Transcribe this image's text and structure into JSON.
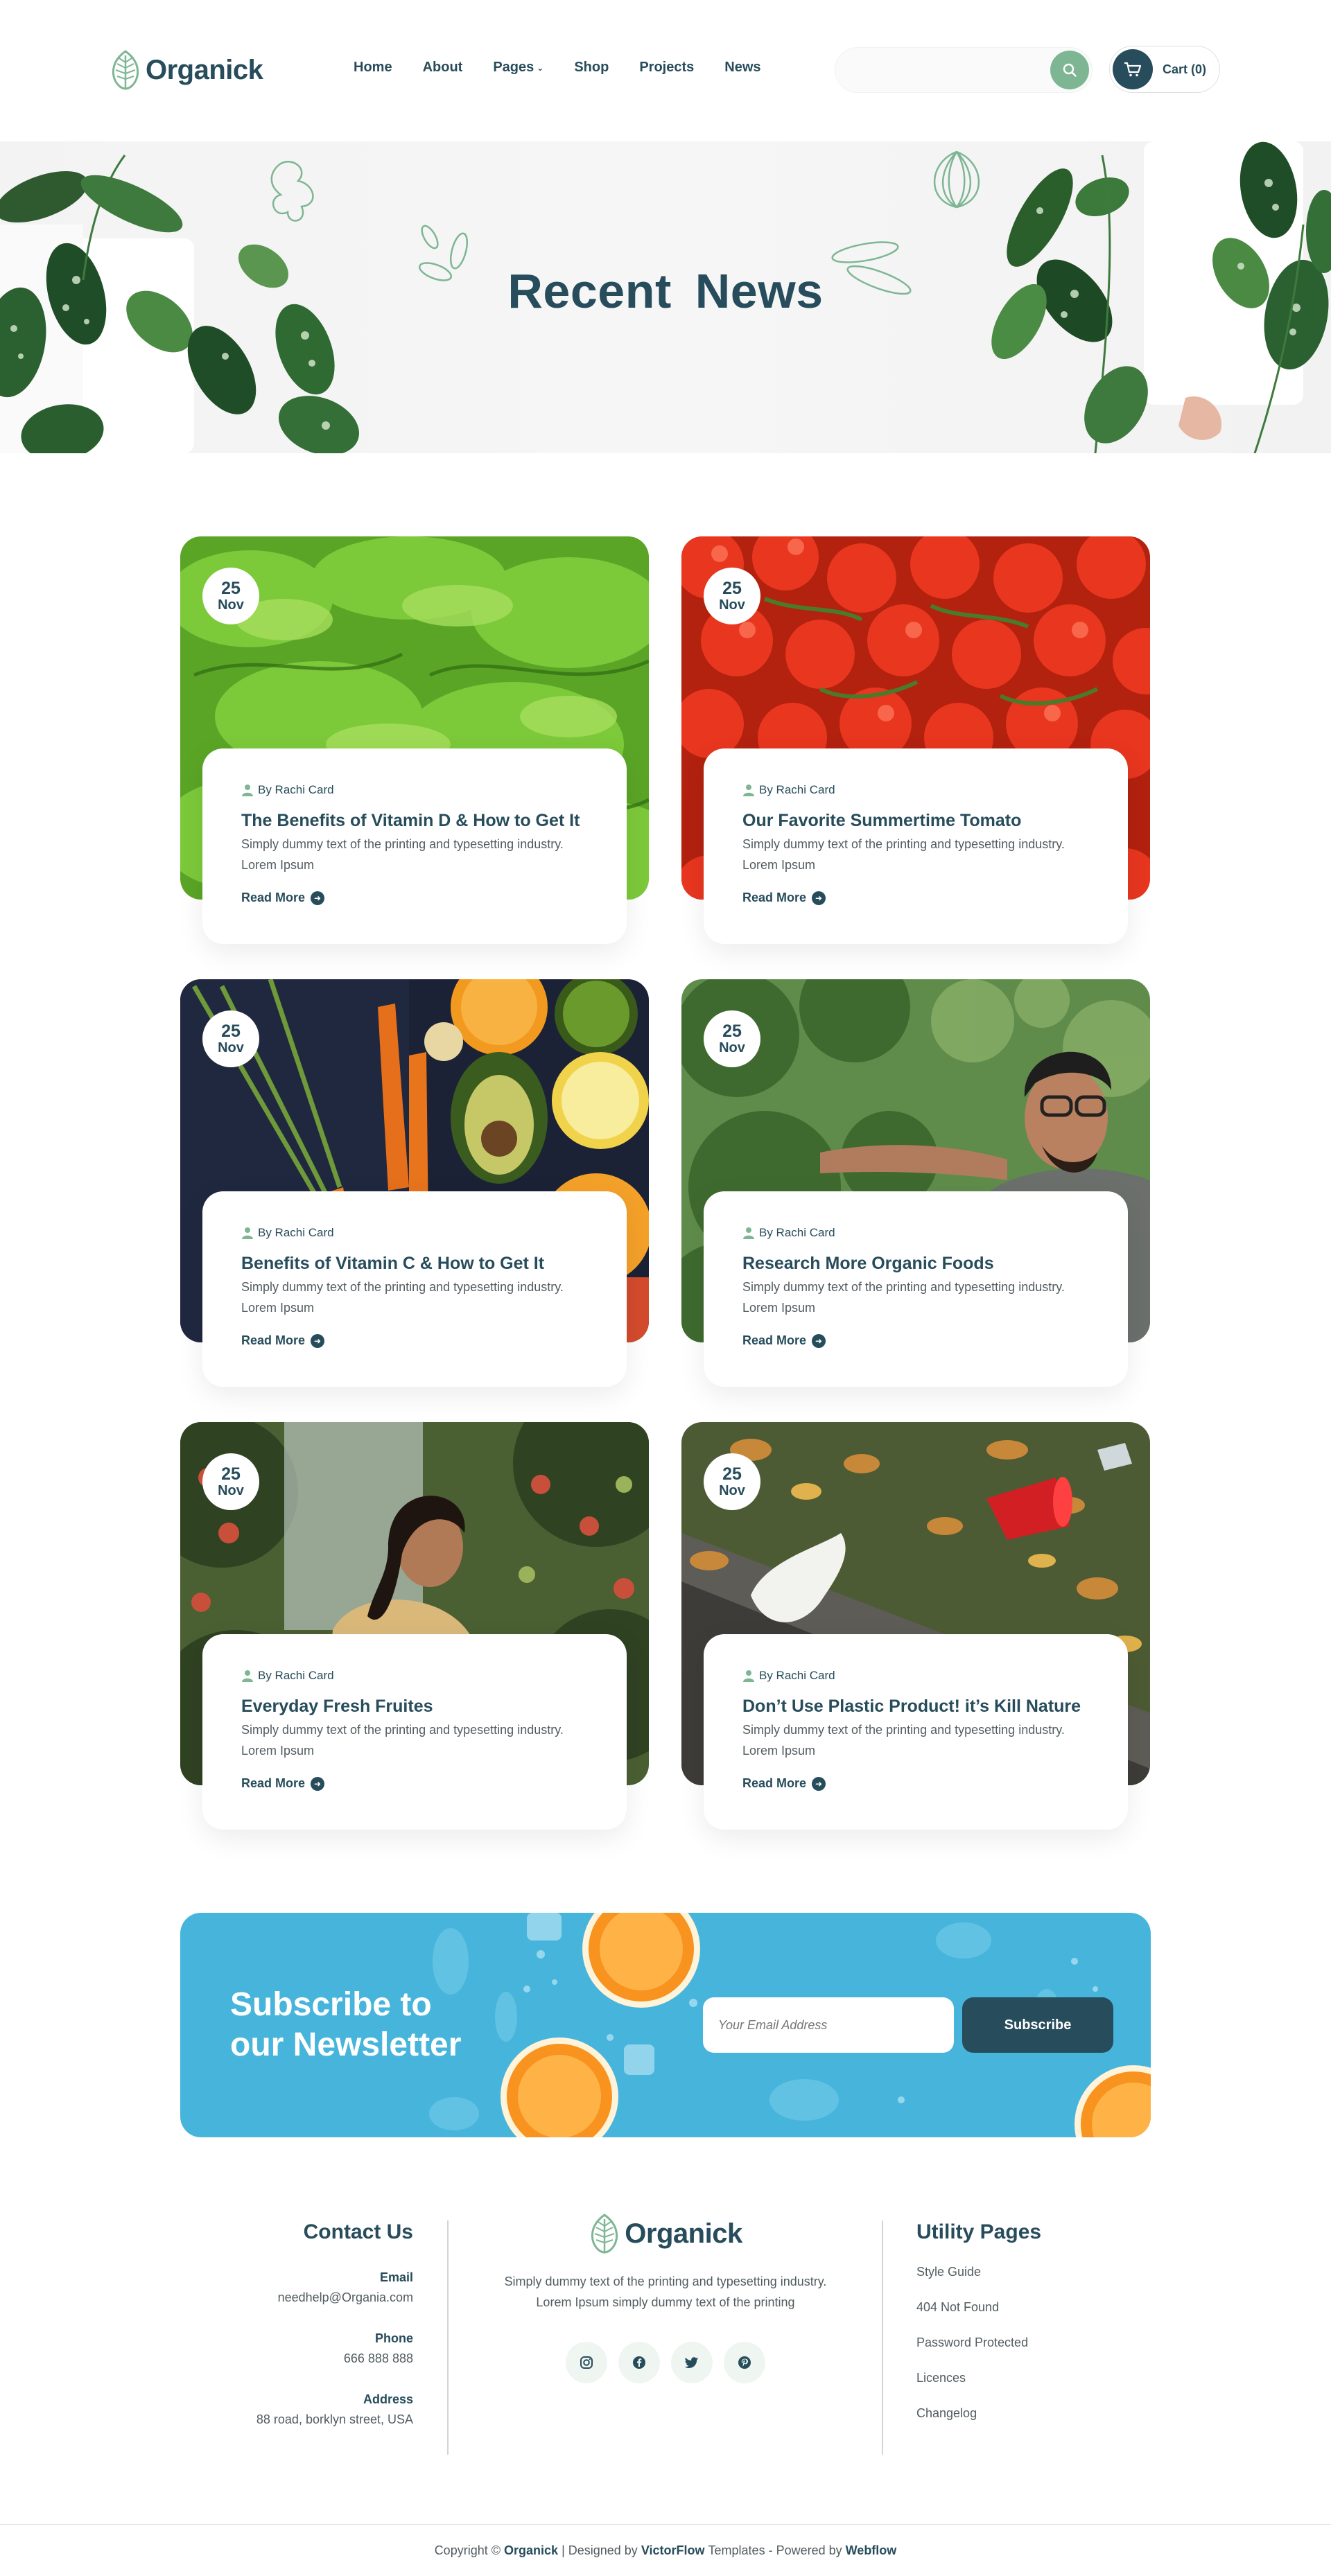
{
  "header": {
    "logo_text": "Organick",
    "nav": [
      {
        "label": "Home"
      },
      {
        "label": "About"
      },
      {
        "label": "Pages"
      },
      {
        "label": "Shop"
      },
      {
        "label": "Projects"
      },
      {
        "label": "News"
      }
    ],
    "search_placeholder": "",
    "cart_label": "Cart (0)"
  },
  "hero": {
    "title": "Recent  News"
  },
  "posts": [
    {
      "day": "25",
      "month": "Nov",
      "author": "By Rachi Card",
      "title": "The Benefits of Vitamin D & How to Get It",
      "desc": "Simply dummy text of the printing and typesetting industry. Lorem Ipsum",
      "read_more": "Read More"
    },
    {
      "day": "25",
      "month": "Nov",
      "author": "By Rachi Card",
      "title": "Our Favorite Summertime Tomato",
      "desc": "Simply dummy text of the printing and typesetting industry. Lorem Ipsum",
      "read_more": "Read More"
    },
    {
      "day": "25",
      "month": "Nov",
      "author": "By Rachi Card",
      "title": "Benefits of Vitamin C & How to Get It",
      "desc": "Simply dummy text of the printing and typesetting industry. Lorem Ipsum",
      "read_more": "Read More"
    },
    {
      "day": "25",
      "month": "Nov",
      "author": "By Rachi Card",
      "title": "Research More Organic Foods",
      "desc": "Simply dummy text of the printing and typesetting industry. Lorem Ipsum",
      "read_more": "Read More"
    },
    {
      "day": "25",
      "month": "Nov",
      "author": "By Rachi Card",
      "title": "Everyday Fresh Fruites",
      "desc": "Simply dummy text of the printing and typesetting industry. Lorem Ipsum",
      "read_more": "Read More"
    },
    {
      "day": "25",
      "month": "Nov",
      "author": "By Rachi Card",
      "title": "Don’t Use Plastic Product! it’s Kill Nature",
      "desc": "Simply dummy text of the printing and typesetting industry. Lorem Ipsum",
      "read_more": "Read More"
    }
  ],
  "newsletter": {
    "title_line1": "Subscribe to",
    "title_line2": "our Newsletter",
    "placeholder": "Your Email Address",
    "button": "Subscribe"
  },
  "footer": {
    "contact": {
      "heading": "Contact Us",
      "email_label": "Email",
      "email": "needhelp@Organia.com",
      "phone_label": "Phone",
      "phone": "666 888 888",
      "address_label": "Address",
      "address": "88 road, borklyn street, USA"
    },
    "center": {
      "logo_text": "Organick",
      "desc_line1": "Simply dummy text of the printing and typesetting industry.",
      "desc_line2": "Lorem Ipsum simply dummy text of the printing"
    },
    "utility": {
      "heading": "Utility Pages",
      "items": [
        "Style Guide",
        "404 Not Found",
        "Password Protected",
        "Licences",
        "Changelog"
      ]
    },
    "copyright": {
      "prefix": "Copyright ©",
      "brand": "Organick",
      "designed": "| Designed by",
      "designer": "VictorFlow",
      "templates": "Templates - Powered by",
      "platform": "Webflow"
    }
  },
  "colors": {
    "primary": "#274C5B",
    "accent": "#7EB693",
    "newsletter_bg": "#47B5DB"
  }
}
